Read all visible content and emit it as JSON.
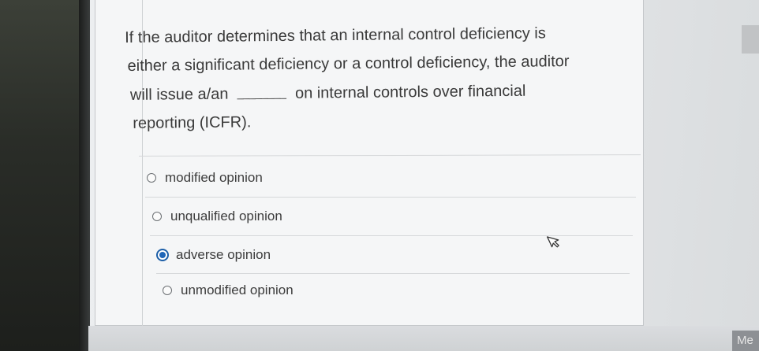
{
  "question": {
    "line1": "If the auditor determines that an internal control deficiency is",
    "line2": "either a significant deficiency or a control deficiency, the auditor",
    "line3_before": "will issue a/an",
    "blank": "________",
    "line3_after": "on internal controls over financial",
    "line4": "reporting (ICFR)."
  },
  "options": [
    {
      "label": "modified opinion",
      "selected": false
    },
    {
      "label": "unqualified opinion",
      "selected": false
    },
    {
      "label": "adverse opinion",
      "selected": true
    },
    {
      "label": "unmodified opinion",
      "selected": false
    }
  ],
  "corner_label": "Me",
  "colors": {
    "selected_radio": "#1f66b8",
    "text": "#3a3a3a",
    "panel_background": "#f5f6f7"
  },
  "icons": {
    "cursor": "hand-pointer-icon",
    "radio": "radio-button-icon"
  }
}
